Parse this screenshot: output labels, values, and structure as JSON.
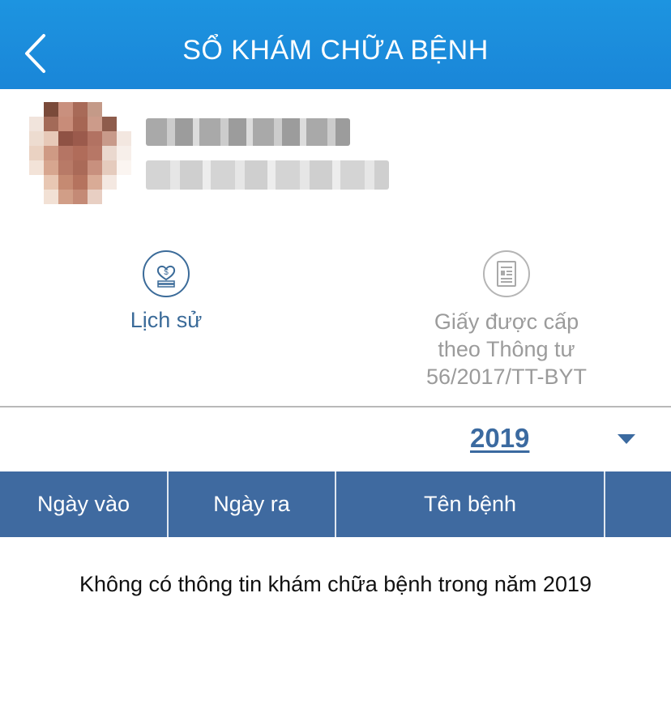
{
  "header": {
    "title": "SỔ KHÁM CHỮA BỆNH",
    "back_icon": "chevron-left-icon"
  },
  "colors": {
    "header": "#1a8ad9",
    "accent": "#3b6aa0",
    "table_header": "#3f6aa0"
  },
  "actions": {
    "history": {
      "label": "Lịch sử",
      "icon": "medical-record-icon"
    },
    "paper": {
      "label": "Giấy được cấp\ntheo Thông tư\n56/2017/TT-BYT",
      "icon": "document-icon"
    }
  },
  "year_select": {
    "value": "2019"
  },
  "table": {
    "columns": [
      "Ngày vào",
      "Ngày ra",
      "Tên bệnh",
      ""
    ]
  },
  "empty_message": "Không có thông tin khám chữa bệnh trong năm 2019"
}
